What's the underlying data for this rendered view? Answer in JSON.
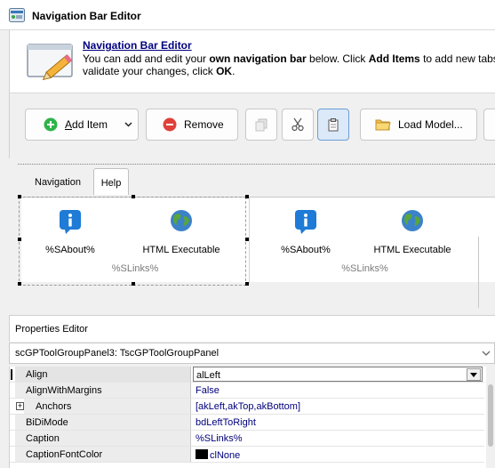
{
  "window": {
    "title": "Navigation Bar Editor"
  },
  "banner": {
    "title": "Navigation Bar Editor",
    "line1_a": "You can add and edit your ",
    "line1_b": "own navigation bar",
    "line1_c": " below. Click ",
    "line1_d": "Add Items",
    "line1_e": " to add new tabs",
    "line2_a": "validate your changes, click ",
    "line2_b": "OK",
    "line2_c": "."
  },
  "toolbar": {
    "add_item_label_prefix": "",
    "add_item_label_accel": "A",
    "add_item_label_rest": "dd Item",
    "remove_label": "Remove",
    "load_model_label": "Load Model..."
  },
  "designer": {
    "tabs": [
      {
        "label": "Navigation",
        "active": false
      },
      {
        "label": "Help",
        "active": true
      }
    ],
    "groups": [
      {
        "caption": "%SLinks%",
        "items": [
          {
            "label": "%SAbout%",
            "icon": "info-icon"
          },
          {
            "label": "HTML Executable",
            "icon": "globe-icon"
          }
        ]
      },
      {
        "caption": "%SLinks%",
        "items": [
          {
            "label": "%SAbout%",
            "icon": "info-icon"
          },
          {
            "label": "HTML Executable",
            "icon": "globe-icon"
          }
        ]
      }
    ]
  },
  "properties": {
    "title": "Properties Editor",
    "selected_object": "scGPToolGroupPanel3: TscGPToolGroupPanel",
    "rows": [
      {
        "name": "Align",
        "value": "alLeft",
        "selected": true
      },
      {
        "name": "AlignWithMargins",
        "value": "False"
      },
      {
        "name": "Anchors",
        "value": "[akLeft,akTop,akBottom]",
        "expandable": true
      },
      {
        "name": "BiDiMode",
        "value": "bdLeftToRight"
      },
      {
        "name": "Caption",
        "value": "%SLinks%"
      },
      {
        "name": "CaptionFontColor",
        "value": "clNone",
        "swatch": "#000000"
      }
    ]
  },
  "colors": {
    "accent_blue": "#1e7bd6",
    "add_green": "#2fb24a",
    "remove_red": "#e0403a",
    "value_text": "#00007b",
    "link_blue": "#000080"
  }
}
